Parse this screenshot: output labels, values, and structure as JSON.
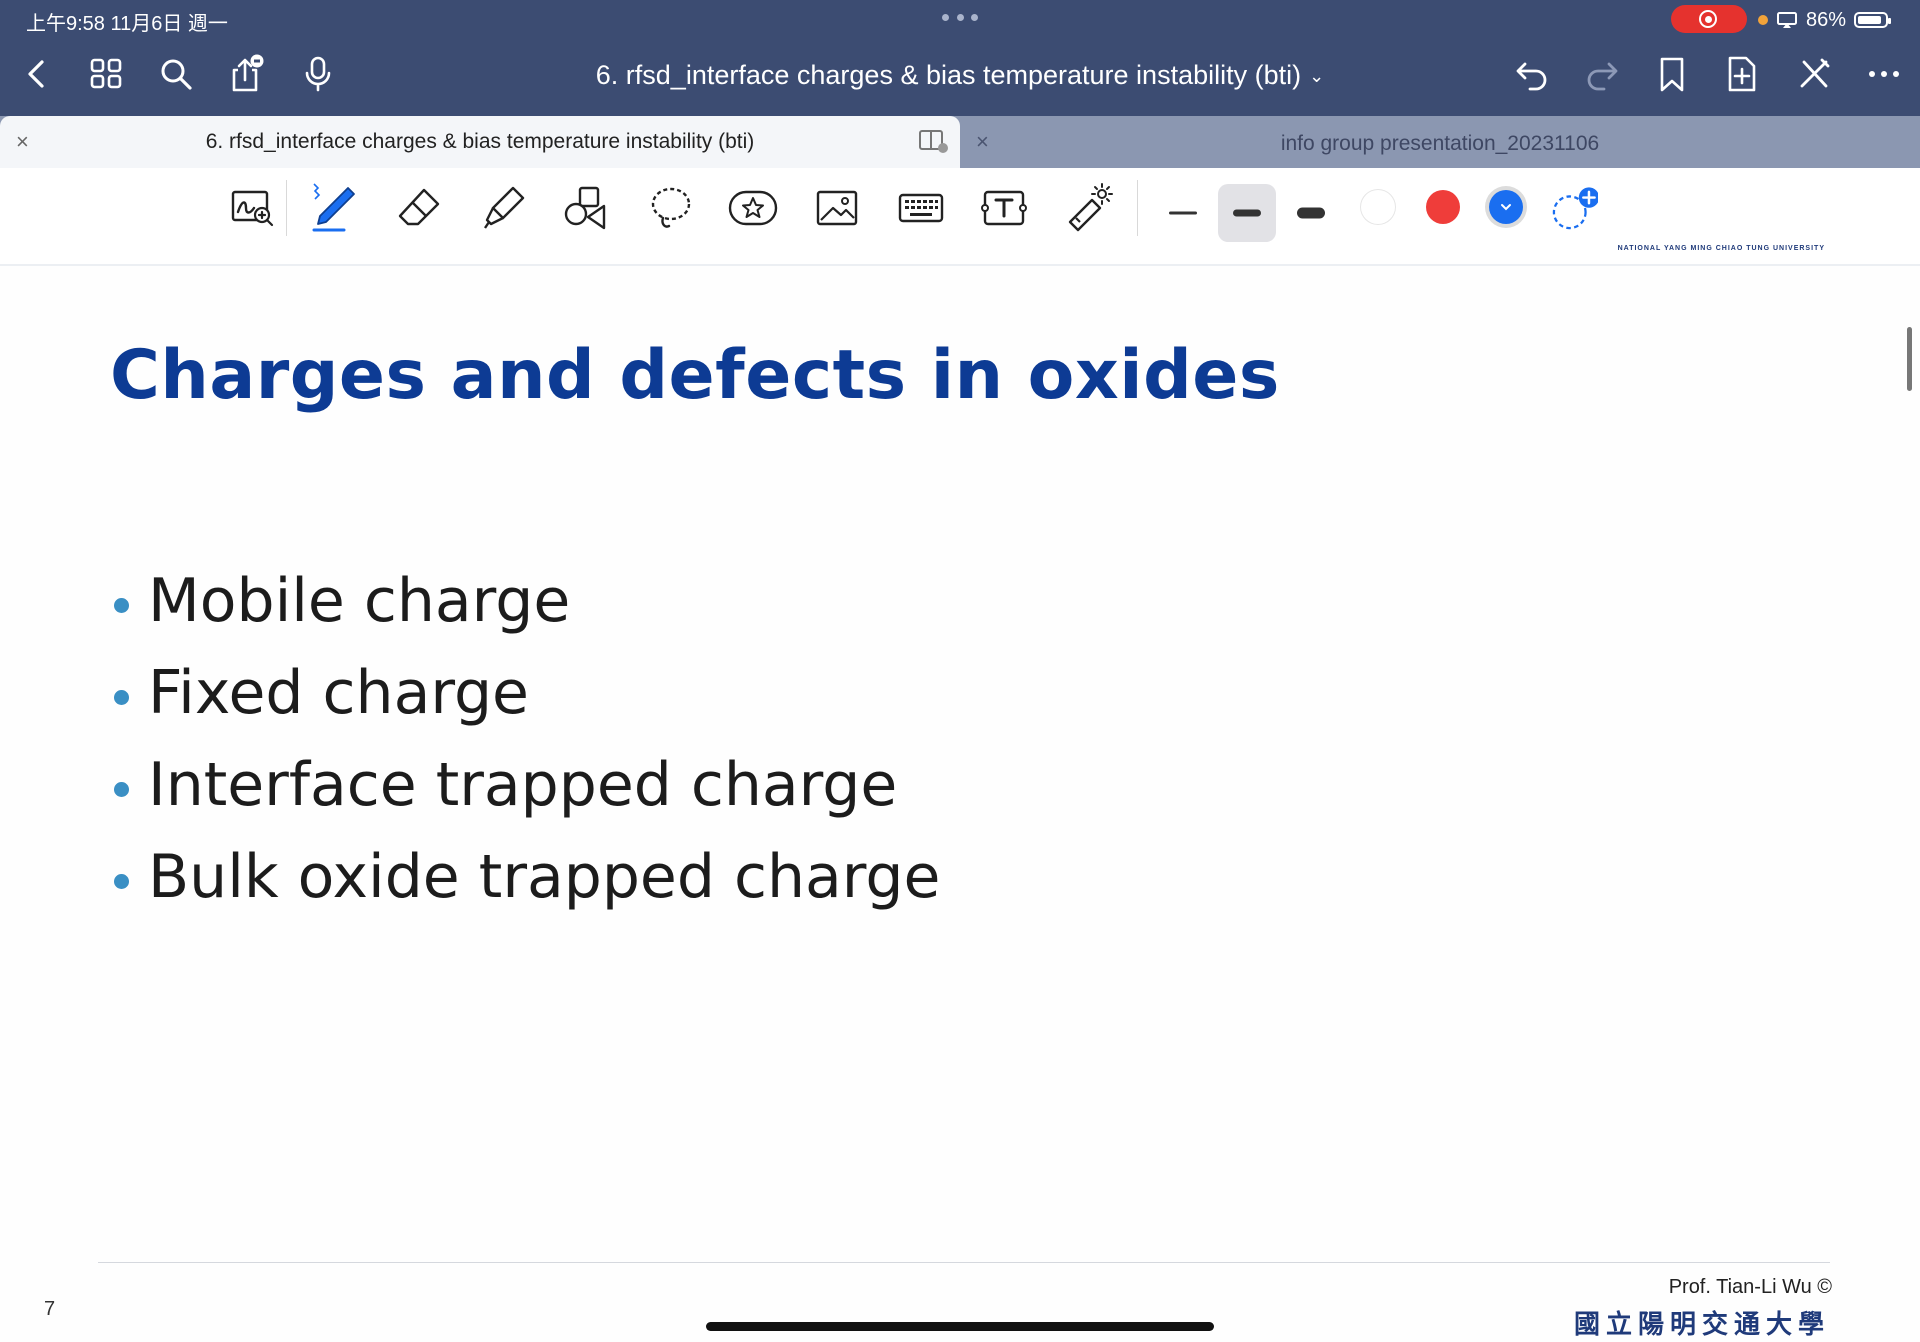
{
  "status_bar": {
    "time": "上午9:58  11月6日 週一",
    "battery": "86%",
    "battery_level": 0.86
  },
  "nav": {
    "title": "6. rfsd_interface charges & bias temperature instability (bti)",
    "title_chevron": "⌄"
  },
  "tabs": [
    {
      "label": "6. rfsd_interface charges & bias temperature instability (bti)",
      "active": true,
      "close": "×"
    },
    {
      "label": "info group presentation_20231106",
      "active": false,
      "close": "×"
    }
  ],
  "toolbar": {
    "tools": [
      "handwriting-zoom",
      "pen",
      "eraser",
      "highlighter",
      "shapes",
      "lasso",
      "stickers",
      "image",
      "keyboard",
      "text-box",
      "laser-pointer"
    ],
    "stroke_widths": [
      "thin",
      "medium",
      "thick"
    ],
    "selected_stroke": "medium",
    "colors": [
      "#ffffff",
      "#ef3d3a",
      "#1a6ef0"
    ],
    "selected_color": "#1a6ef0"
  },
  "slide": {
    "title": "Charges and defects in oxides",
    "bullets": [
      "Mobile charge",
      "Fixed charge",
      "Interface trapped charge",
      "Bulk oxide trapped charge"
    ],
    "page_number": "7",
    "author": "Prof. Tian-Li Wu ©",
    "university_cn": "國立陽明交通大學",
    "university_en": "NATIONAL YANG MING CHIAO TUNG UNIVERSITY"
  }
}
